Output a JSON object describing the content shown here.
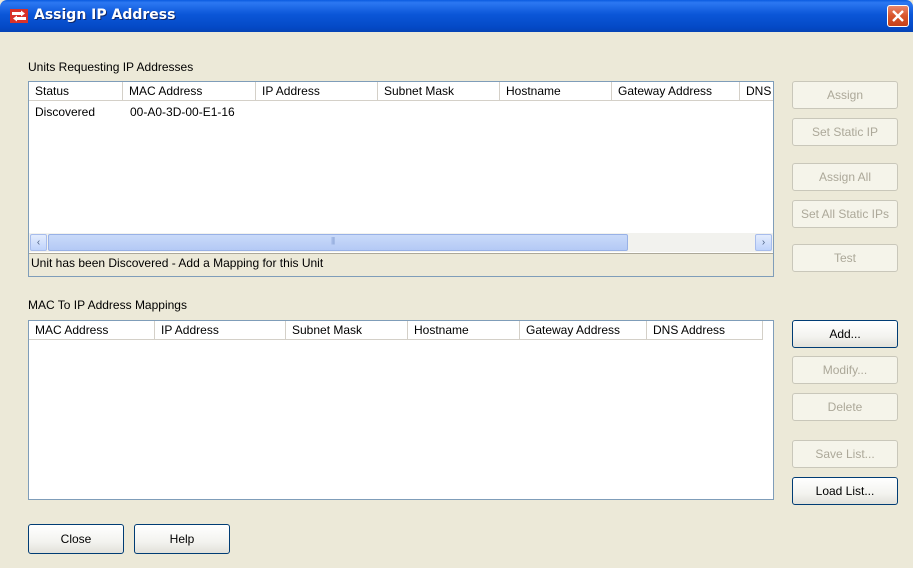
{
  "window": {
    "title": "Assign IP Address",
    "titlebar_color": "#0b56d8"
  },
  "units_section": {
    "label": "Units Requesting IP Addresses",
    "columns": [
      "Status",
      "MAC Address",
      "IP Address",
      "Subnet Mask",
      "Hostname",
      "Gateway Address",
      "DNS"
    ],
    "rows": [
      {
        "status": "Discovered",
        "mac": "00-A0-3D-00-E1-16",
        "ip": "",
        "subnet": "",
        "hostname": "",
        "gateway": "",
        "dns": ""
      }
    ],
    "scrollbar": {
      "left_arrow": "‹",
      "right_arrow": "›",
      "thumb_grip": "|||"
    },
    "status_text": "Unit has been Discovered - Add a Mapping for this Unit"
  },
  "units_buttons": {
    "assign": "Assign",
    "set_static_ip": "Set Static IP",
    "assign_all": "Assign All",
    "set_all_static_ips": "Set All Static IPs",
    "test": "Test"
  },
  "mappings_section": {
    "label": "MAC To IP Address Mappings",
    "columns": [
      "MAC Address",
      "IP Address",
      "Subnet Mask",
      "Hostname",
      "Gateway Address",
      "DNS Address"
    ]
  },
  "mappings_buttons": {
    "add": "Add...",
    "modify": "Modify...",
    "delete": "Delete",
    "save_list": "Save List...",
    "load_list": "Load List..."
  },
  "footer_buttons": {
    "close": "Close",
    "help": "Help"
  }
}
